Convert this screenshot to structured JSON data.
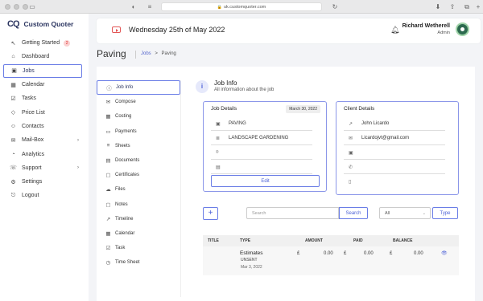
{
  "browser": {
    "url": "uk.customquoter.com"
  },
  "app": {
    "name": "Custom Quoter",
    "logo": "CQ"
  },
  "sidebar": {
    "items": [
      {
        "label": "Getting Started",
        "icon": "cursor-icon",
        "badge": "2"
      },
      {
        "label": "Dashboard",
        "icon": "home-icon"
      },
      {
        "label": "Jobs",
        "icon": "briefcase-icon",
        "active": true
      },
      {
        "label": "Calendar",
        "icon": "calendar-icon"
      },
      {
        "label": "Tasks",
        "icon": "checklist-icon"
      },
      {
        "label": "Price List",
        "icon": "tag-icon"
      },
      {
        "label": "Contacts",
        "icon": "contacts-icon"
      },
      {
        "label": "Mail-Box",
        "icon": "mail-icon",
        "chevron": true
      },
      {
        "label": "Analytics",
        "icon": "analytics-icon"
      },
      {
        "label": "Support",
        "icon": "support-icon",
        "chevron": true
      },
      {
        "label": "Settings",
        "icon": "gear-icon"
      },
      {
        "label": "Logout",
        "icon": "logout-icon"
      }
    ]
  },
  "header": {
    "date": "Wednesday 25th of May 2022",
    "user_name": "Richard Wetherell",
    "user_role": "Admin"
  },
  "page": {
    "title": "Paving",
    "breadcrumb_link": "Jobs",
    "breadcrumb_sep": ">",
    "breadcrumb_current": "Paving"
  },
  "subnav": {
    "items": [
      {
        "label": "Job Info",
        "active": true
      },
      {
        "label": "Compose"
      },
      {
        "label": "Costing"
      },
      {
        "label": "Payments"
      },
      {
        "label": "Sheets"
      },
      {
        "label": "Documents"
      },
      {
        "label": "Certificates"
      },
      {
        "label": "Files"
      },
      {
        "label": "Notes"
      },
      {
        "label": "Timeline"
      },
      {
        "label": "Calendar"
      },
      {
        "label": "Task"
      },
      {
        "label": "Time Sheet"
      }
    ]
  },
  "job_info": {
    "title": "Job Info",
    "subtitle": "All information about the job",
    "details": {
      "title": "Job Details",
      "date": "March 30, 2022",
      "name": "PAVING",
      "category": "LANDSCAPE GARDENING",
      "location": "",
      "notes": "",
      "edit_label": "Edit"
    },
    "client": {
      "title": "Client Details",
      "name": "John Licardo",
      "email": "Licardojvt@gmail.com",
      "company": "",
      "phone": "",
      "mobile": ""
    }
  },
  "toolbar": {
    "add_label": "+",
    "search_placeholder": "Search",
    "search_label": "Search",
    "filter_value": "All",
    "type_label": "Type"
  },
  "table": {
    "columns": [
      "TITLE",
      "TYPE",
      "AMOUNT",
      "PAID",
      "BALANCE"
    ],
    "rows": [
      {
        "type": "Estimates",
        "status": "UNSENT",
        "date": "Mar 3, 2022",
        "currency": "£",
        "amount": "0.00",
        "paid": "0.00",
        "balance": "0.00"
      }
    ]
  }
}
